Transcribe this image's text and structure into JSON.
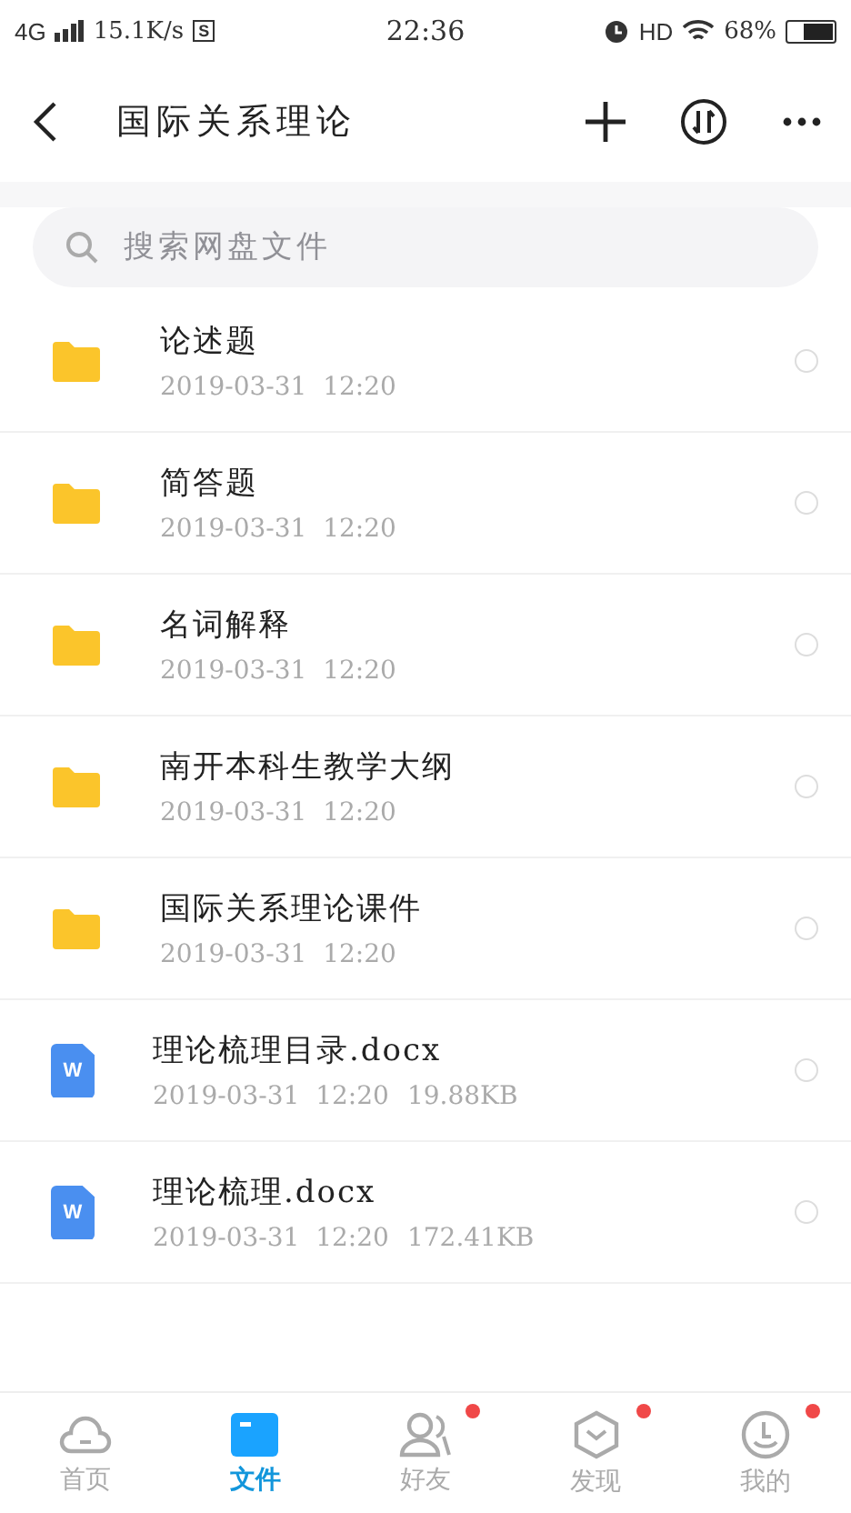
{
  "status_bar": {
    "network": "4G",
    "speed": "15.1K/s",
    "app_badge": "S",
    "time": "22:36",
    "hd": "HD",
    "battery": "68%"
  },
  "header": {
    "title": "国际关系理论"
  },
  "search": {
    "placeholder": "搜索网盘文件"
  },
  "files": [
    {
      "kind": "folder",
      "name": "论述题",
      "date": "2019-03-31  12:20",
      "selected": false
    },
    {
      "kind": "folder",
      "name": "简答题",
      "date": "2019-03-31  12:20",
      "selected": false
    },
    {
      "kind": "folder",
      "name": "名词解释",
      "date": "2019-03-31  12:20",
      "selected": false
    },
    {
      "kind": "folder",
      "name": "南开本科生教学大纲",
      "date": "2019-03-31  12:20",
      "selected": false
    },
    {
      "kind": "folder",
      "name": "国际关系理论课件",
      "date": "2019-03-31  12:20",
      "selected": false
    },
    {
      "kind": "doc",
      "icon_letter": "W",
      "name": "理论梳理目录.docx",
      "date": "2019-03-31  12:20",
      "size": "19.88KB",
      "selected": false
    },
    {
      "kind": "doc",
      "icon_letter": "W",
      "name": "理论梳理.docx",
      "date": "2019-03-31  12:20",
      "size": "172.41KB",
      "selected": false
    }
  ],
  "nav": [
    {
      "kind": "home",
      "label": "首页",
      "selected": false,
      "dot": false
    },
    {
      "kind": "files",
      "label": "文件",
      "selected": true,
      "dot": false
    },
    {
      "kind": "friends",
      "label": "好友",
      "selected": false,
      "dot": true
    },
    {
      "kind": "discover",
      "label": "发现",
      "selected": false,
      "dot": true
    },
    {
      "kind": "me",
      "label": "我的",
      "selected": false,
      "dot": true
    }
  ]
}
